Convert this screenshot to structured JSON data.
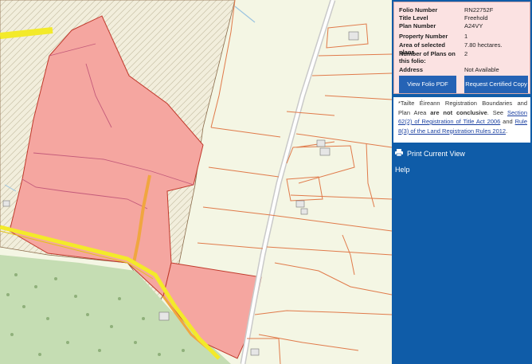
{
  "folio": {
    "rows": [
      {
        "label": "Folio Number",
        "value": "RN22752F"
      },
      {
        "label": "Title Level",
        "value": "Freehold"
      },
      {
        "label": "Plan Number",
        "value": "A24VY"
      },
      {
        "label": "Property Number",
        "value": "1"
      },
      {
        "label": "Area of selected plans",
        "value": "7.80 hectares."
      },
      {
        "label": "Number of Plans on this folio:",
        "value": "2"
      },
      {
        "label": "Address",
        "value": "Not Available"
      }
    ],
    "view_pdf_label": "View Folio PDF",
    "request_copy_label": "Request Certified Copy"
  },
  "notice": {
    "prefix": "*Tailte Éireann Registration Boundaries and Plan Area ",
    "bold": "are not conclusive",
    "mid1": ". See ",
    "link1": "Section 62(2) of Registration of Title Act 2006",
    "mid2": " and ",
    "link2": "Rule 8(3) of the Land Registration Rules 2012",
    "suffix": "."
  },
  "menu": {
    "print_label": "Print Current View",
    "help_label": "Help"
  },
  "icons": {
    "print": "printer-icon"
  },
  "colors": {
    "panel_bg": "#0f5ca8",
    "folio_bg": "#fbe2e2",
    "button_bg": "#2563b5",
    "parcel_fill": "#f5a6a0",
    "boundary_line": "#e06a3a",
    "road_yellow": "#f3ea2a",
    "forest_green": "#c5ddb3",
    "field_bg": "#f4f6e4"
  }
}
